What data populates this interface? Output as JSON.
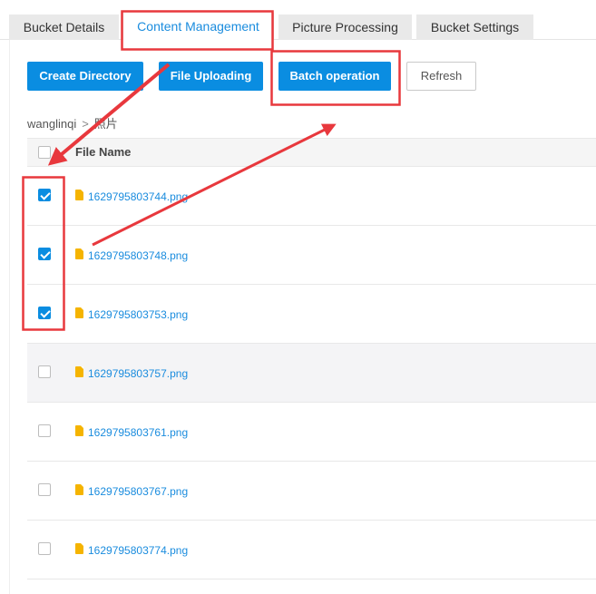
{
  "tabs": [
    {
      "label": "Bucket Details",
      "active": false
    },
    {
      "label": "Content Management",
      "active": true
    },
    {
      "label": "Picture Processing",
      "active": false
    },
    {
      "label": "Bucket Settings",
      "active": false
    }
  ],
  "toolbar": {
    "create_directory": "Create Directory",
    "file_uploading": "File Uploading",
    "batch_operation": "Batch operation",
    "refresh": "Refresh"
  },
  "breadcrumb": {
    "root": "wanglinqi",
    "separator": ">",
    "current": "照片"
  },
  "table": {
    "header_file_name": "File Name",
    "rows": [
      {
        "name": "1629795803744.png",
        "checked": true
      },
      {
        "name": "1629795803748.png",
        "checked": true
      },
      {
        "name": "1629795803753.png",
        "checked": true
      },
      {
        "name": "1629795803757.png",
        "checked": false
      },
      {
        "name": "1629795803761.png",
        "checked": false
      },
      {
        "name": "1629795803767.png",
        "checked": false
      },
      {
        "name": "1629795803774.png",
        "checked": false
      }
    ]
  },
  "colors": {
    "primary": "#0a8de1",
    "annotation": "#e8383d",
    "file_icon": "#f5b400",
    "link": "#1a8cde"
  }
}
